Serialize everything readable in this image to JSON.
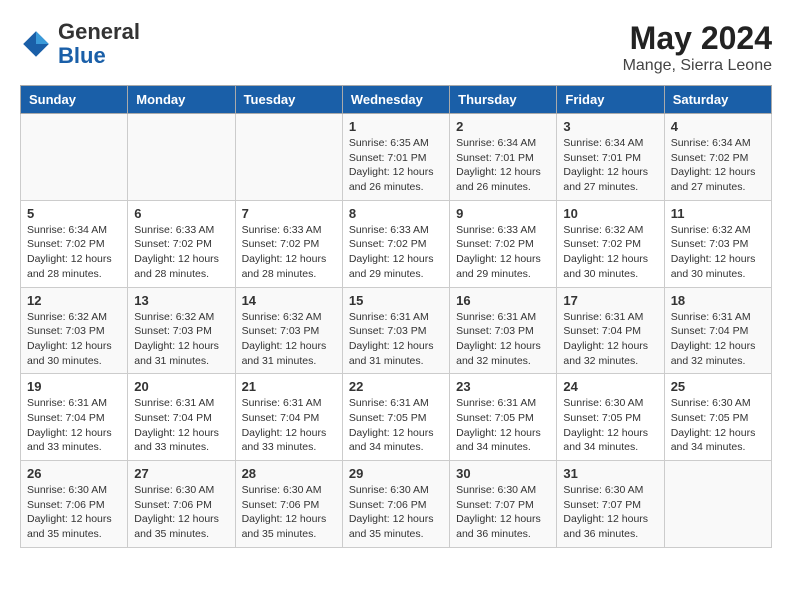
{
  "logo": {
    "general": "General",
    "blue": "Blue"
  },
  "title": "May 2024",
  "location": "Mange, Sierra Leone",
  "days_of_week": [
    "Sunday",
    "Monday",
    "Tuesday",
    "Wednesday",
    "Thursday",
    "Friday",
    "Saturday"
  ],
  "weeks": [
    [
      {
        "day": "",
        "info": ""
      },
      {
        "day": "",
        "info": ""
      },
      {
        "day": "",
        "info": ""
      },
      {
        "day": "1",
        "info": "Sunrise: 6:35 AM\nSunset: 7:01 PM\nDaylight: 12 hours\nand 26 minutes."
      },
      {
        "day": "2",
        "info": "Sunrise: 6:34 AM\nSunset: 7:01 PM\nDaylight: 12 hours\nand 26 minutes."
      },
      {
        "day": "3",
        "info": "Sunrise: 6:34 AM\nSunset: 7:01 PM\nDaylight: 12 hours\nand 27 minutes."
      },
      {
        "day": "4",
        "info": "Sunrise: 6:34 AM\nSunset: 7:02 PM\nDaylight: 12 hours\nand 27 minutes."
      }
    ],
    [
      {
        "day": "5",
        "info": "Sunrise: 6:34 AM\nSunset: 7:02 PM\nDaylight: 12 hours\nand 28 minutes."
      },
      {
        "day": "6",
        "info": "Sunrise: 6:33 AM\nSunset: 7:02 PM\nDaylight: 12 hours\nand 28 minutes."
      },
      {
        "day": "7",
        "info": "Sunrise: 6:33 AM\nSunset: 7:02 PM\nDaylight: 12 hours\nand 28 minutes."
      },
      {
        "day": "8",
        "info": "Sunrise: 6:33 AM\nSunset: 7:02 PM\nDaylight: 12 hours\nand 29 minutes."
      },
      {
        "day": "9",
        "info": "Sunrise: 6:33 AM\nSunset: 7:02 PM\nDaylight: 12 hours\nand 29 minutes."
      },
      {
        "day": "10",
        "info": "Sunrise: 6:32 AM\nSunset: 7:02 PM\nDaylight: 12 hours\nand 30 minutes."
      },
      {
        "day": "11",
        "info": "Sunrise: 6:32 AM\nSunset: 7:03 PM\nDaylight: 12 hours\nand 30 minutes."
      }
    ],
    [
      {
        "day": "12",
        "info": "Sunrise: 6:32 AM\nSunset: 7:03 PM\nDaylight: 12 hours\nand 30 minutes."
      },
      {
        "day": "13",
        "info": "Sunrise: 6:32 AM\nSunset: 7:03 PM\nDaylight: 12 hours\nand 31 minutes."
      },
      {
        "day": "14",
        "info": "Sunrise: 6:32 AM\nSunset: 7:03 PM\nDaylight: 12 hours\nand 31 minutes."
      },
      {
        "day": "15",
        "info": "Sunrise: 6:31 AM\nSunset: 7:03 PM\nDaylight: 12 hours\nand 31 minutes."
      },
      {
        "day": "16",
        "info": "Sunrise: 6:31 AM\nSunset: 7:03 PM\nDaylight: 12 hours\nand 32 minutes."
      },
      {
        "day": "17",
        "info": "Sunrise: 6:31 AM\nSunset: 7:04 PM\nDaylight: 12 hours\nand 32 minutes."
      },
      {
        "day": "18",
        "info": "Sunrise: 6:31 AM\nSunset: 7:04 PM\nDaylight: 12 hours\nand 32 minutes."
      }
    ],
    [
      {
        "day": "19",
        "info": "Sunrise: 6:31 AM\nSunset: 7:04 PM\nDaylight: 12 hours\nand 33 minutes."
      },
      {
        "day": "20",
        "info": "Sunrise: 6:31 AM\nSunset: 7:04 PM\nDaylight: 12 hours\nand 33 minutes."
      },
      {
        "day": "21",
        "info": "Sunrise: 6:31 AM\nSunset: 7:04 PM\nDaylight: 12 hours\nand 33 minutes."
      },
      {
        "day": "22",
        "info": "Sunrise: 6:31 AM\nSunset: 7:05 PM\nDaylight: 12 hours\nand 34 minutes."
      },
      {
        "day": "23",
        "info": "Sunrise: 6:31 AM\nSunset: 7:05 PM\nDaylight: 12 hours\nand 34 minutes."
      },
      {
        "day": "24",
        "info": "Sunrise: 6:30 AM\nSunset: 7:05 PM\nDaylight: 12 hours\nand 34 minutes."
      },
      {
        "day": "25",
        "info": "Sunrise: 6:30 AM\nSunset: 7:05 PM\nDaylight: 12 hours\nand 34 minutes."
      }
    ],
    [
      {
        "day": "26",
        "info": "Sunrise: 6:30 AM\nSunset: 7:06 PM\nDaylight: 12 hours\nand 35 minutes."
      },
      {
        "day": "27",
        "info": "Sunrise: 6:30 AM\nSunset: 7:06 PM\nDaylight: 12 hours\nand 35 minutes."
      },
      {
        "day": "28",
        "info": "Sunrise: 6:30 AM\nSunset: 7:06 PM\nDaylight: 12 hours\nand 35 minutes."
      },
      {
        "day": "29",
        "info": "Sunrise: 6:30 AM\nSunset: 7:06 PM\nDaylight: 12 hours\nand 35 minutes."
      },
      {
        "day": "30",
        "info": "Sunrise: 6:30 AM\nSunset: 7:07 PM\nDaylight: 12 hours\nand 36 minutes."
      },
      {
        "day": "31",
        "info": "Sunrise: 6:30 AM\nSunset: 7:07 PM\nDaylight: 12 hours\nand 36 minutes."
      },
      {
        "day": "",
        "info": ""
      }
    ]
  ]
}
